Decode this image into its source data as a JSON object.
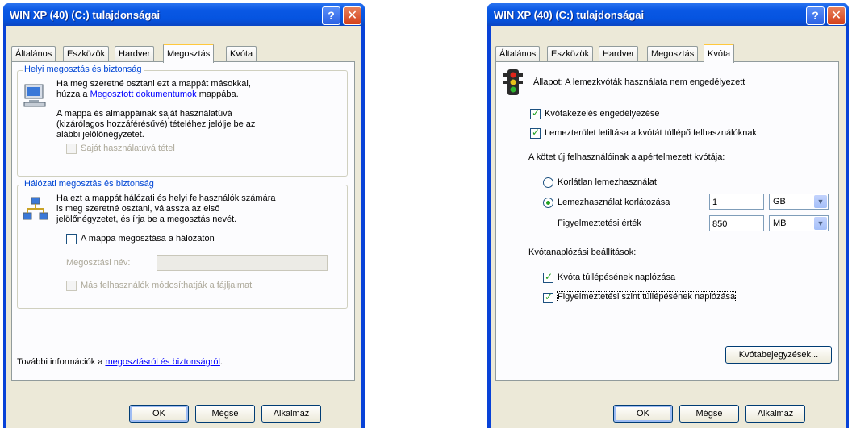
{
  "dialog1": {
    "title": "WIN XP (40) (C:) tulajdonságai",
    "help": "?",
    "close": "✕",
    "tabs": [
      "Általános",
      "Eszközök",
      "Hardver",
      "Megosztás",
      "Kvóta"
    ],
    "active_tab": "Megosztás",
    "local_group": {
      "title": "Helyi megosztás és biztonság",
      "text1": "Ha meg szeretné osztani ezt a mappát másokkal,",
      "text2_prefix": "húzza a ",
      "text2_link": "Megosztott dokumentumok",
      "text2_suffix": " mappába.",
      "para2": [
        "A mappa és almappáinak saját használatúvá",
        "(kizárólagos hozzáférésűvé) tételéhez jelölje be az",
        "alábbi jelölőnégyzetet."
      ],
      "private_label": "Saját használatúvá tétel"
    },
    "net_group": {
      "title": "Hálózati megosztás és biztonság",
      "para": [
        "Ha ezt a mappát hálózati és helyi felhasználók számára",
        "is meg szeretné osztani, válassza az első",
        "jelölőnégyzetet, és írja be a megosztás nevét."
      ],
      "share_label": "A mappa megosztása a hálózaton",
      "share_name_label": "Megosztási név:",
      "share_name_value": "",
      "modify_label": "Más felhasználók módosíthatják a fájljaimat"
    },
    "more_info_prefix": "További információk a ",
    "more_info_link": "megosztásról és biztonságról",
    "more_info_suffix": ".",
    "ok": "OK",
    "cancel": "Mégse",
    "apply": "Alkalmaz"
  },
  "dialog2": {
    "title": "WIN XP (40) (C:) tulajdonságai",
    "help": "?",
    "close": "✕",
    "tabs": [
      "Általános",
      "Eszközök",
      "Hardver",
      "Megosztás",
      "Kvóta"
    ],
    "active_tab": "Kvóta",
    "status": "Állapot: A lemezkvóták használata nem engedélyezett",
    "enable_quota": "Kvótakezelés engedélyezése",
    "deny_space": "Lemezterület letiltása a kvótát túllépő felhasználóknak",
    "default_quota_label": "A kötet új felhasználóinak alapértelmezett kvótája:",
    "no_limit": "Korlátlan lemezhasználat",
    "limit": "Lemezhasználat korlátozása",
    "limit_value": "1",
    "limit_unit": "GB",
    "warning_label": "Figyelmeztetési érték",
    "warning_value": "850",
    "warning_unit": "MB",
    "log_label": "Kvótanaplózási beállítások:",
    "log_exceed": "Kvóta túllépésének naplózása",
    "log_warning": "Figyelmeztetési szint túllépésének naplózása",
    "entries_button": "Kvótabejegyzések...",
    "ok": "OK",
    "cancel": "Mégse",
    "apply": "Alkalmaz"
  }
}
